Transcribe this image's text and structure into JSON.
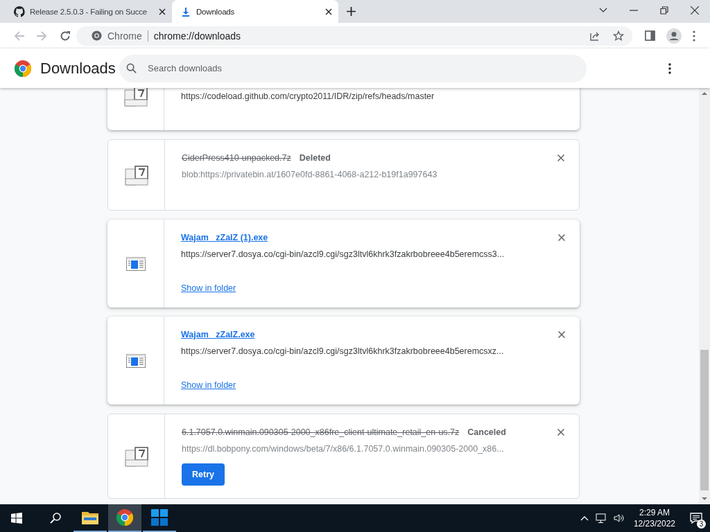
{
  "tabs": [
    {
      "title": "Release 2.5.0.3 - Failing on Succe",
      "selected": false
    },
    {
      "title": "Downloads",
      "selected": true
    }
  ],
  "omnibox": {
    "site": "Chrome",
    "url": "chrome://downloads"
  },
  "header": {
    "title": "Downloads",
    "search": {
      "placeholder": "Search downloads"
    }
  },
  "downloads": [
    {
      "kind": "archive",
      "url": "https://codeload.github.com/crypto2011/IDR/zip/refs/heads/master"
    },
    {
      "kind": "deleted",
      "name": "CiderPress410-unpacked.7z",
      "status": "Deleted",
      "url": "blob:https://privatebin.at/1607e0fd-8861-4068-a212-b19f1a997643"
    },
    {
      "kind": "program",
      "name": "Wajam _zZaIZ (1).exe",
      "url": "https://server7.dosya.co/cgi-bin/azcl9.cgi/sgz3ltvl6khrk3fzakrbobreee4b5eremcss3...",
      "action": "Show in folder"
    },
    {
      "kind": "program",
      "name": "Wajam _zZaIZ.exe",
      "url": "https://server7.dosya.co/cgi-bin/azcl9.cgi/sgz3ltvl6khrk3fzakrbobreee4b5eremcsxz...",
      "action": "Show in folder"
    },
    {
      "kind": "canceled",
      "name": "6.1.7057.0.winmain.090305-2000_x86fre_client-ultimate_retail_en-us.7z",
      "status": "Canceled",
      "url": "https://dl.bobpony.com/windows/beta/7/x86/6.1.7057.0.winmain.090305-2000_x86...",
      "action": "Retry"
    }
  ],
  "taskbar": {
    "apps": [
      {
        "kind": "folder",
        "selected": false
      },
      {
        "kind": "browser",
        "selected": true
      },
      {
        "kind": "tiles",
        "selected": false
      }
    ],
    "time": "2:29 AM",
    "date": "12/23/2022",
    "notifications": "3"
  }
}
